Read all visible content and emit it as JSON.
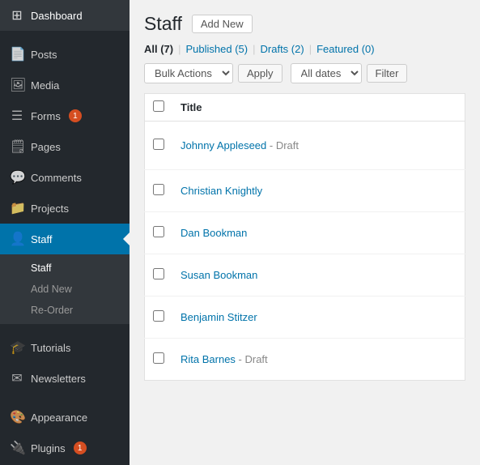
{
  "sidebar": {
    "items": [
      {
        "id": "dashboard",
        "label": "Dashboard",
        "icon": "⊞",
        "active": false
      },
      {
        "id": "posts",
        "label": "Posts",
        "icon": "📄",
        "active": false
      },
      {
        "id": "media",
        "label": "Media",
        "icon": "🖼",
        "active": false
      },
      {
        "id": "forms",
        "label": "Forms",
        "icon": "☰",
        "badge": "1",
        "active": false
      },
      {
        "id": "pages",
        "label": "Pages",
        "icon": "🗒",
        "active": false
      },
      {
        "id": "comments",
        "label": "Comments",
        "icon": "💬",
        "active": false
      },
      {
        "id": "projects",
        "label": "Projects",
        "icon": "📁",
        "active": false
      },
      {
        "id": "staff",
        "label": "Staff",
        "icon": "👤",
        "active": true
      }
    ],
    "sub_menu": [
      {
        "id": "staff-root",
        "label": "Staff",
        "active": true
      },
      {
        "id": "add-new",
        "label": "Add New",
        "active": false
      },
      {
        "id": "re-order",
        "label": "Re-Order",
        "active": false
      }
    ],
    "items_below": [
      {
        "id": "tutorials",
        "label": "Tutorials",
        "icon": "🎓",
        "active": false
      },
      {
        "id": "newsletters",
        "label": "Newsletters",
        "icon": "✉",
        "active": false
      },
      {
        "id": "appearance",
        "label": "Appearance",
        "icon": "🎨",
        "active": false
      },
      {
        "id": "plugins",
        "label": "Plugins",
        "icon": "🔌",
        "badge": "1",
        "active": false
      }
    ]
  },
  "page": {
    "title": "Staff",
    "add_new_label": "Add New"
  },
  "filter_tabs": [
    {
      "id": "all",
      "label": "All",
      "count": "7",
      "active": true
    },
    {
      "id": "published",
      "label": "Published",
      "count": "5",
      "active": false
    },
    {
      "id": "drafts",
      "label": "Drafts",
      "count": "2",
      "active": false
    },
    {
      "id": "featured",
      "label": "Featured",
      "count": "0",
      "active": false
    }
  ],
  "toolbar": {
    "bulk_actions_label": "Bulk Actions",
    "apply_label": "Apply",
    "all_dates_label": "All dates",
    "filter_label": "Filter"
  },
  "table": {
    "columns": [
      {
        "id": "cb",
        "label": ""
      },
      {
        "id": "title",
        "label": "Title"
      }
    ],
    "rows": [
      {
        "id": 1,
        "name": "Johnny Appleseed",
        "status": "Draft",
        "is_draft": true
      },
      {
        "id": 2,
        "name": "Christian Knightly",
        "status": "",
        "is_draft": false
      },
      {
        "id": 3,
        "name": "Dan Bookman",
        "status": "",
        "is_draft": false
      },
      {
        "id": 4,
        "name": "Susan Bookman",
        "status": "",
        "is_draft": false
      },
      {
        "id": 5,
        "name": "Benjamin Stitzer",
        "status": "",
        "is_draft": false
      },
      {
        "id": 6,
        "name": "Rita Barnes",
        "status": "Draft",
        "is_draft": true
      }
    ]
  },
  "colors": {
    "sidebar_bg": "#23282d",
    "sidebar_active": "#0073aa",
    "link_color": "#0073aa",
    "text_dark": "#23282d"
  }
}
